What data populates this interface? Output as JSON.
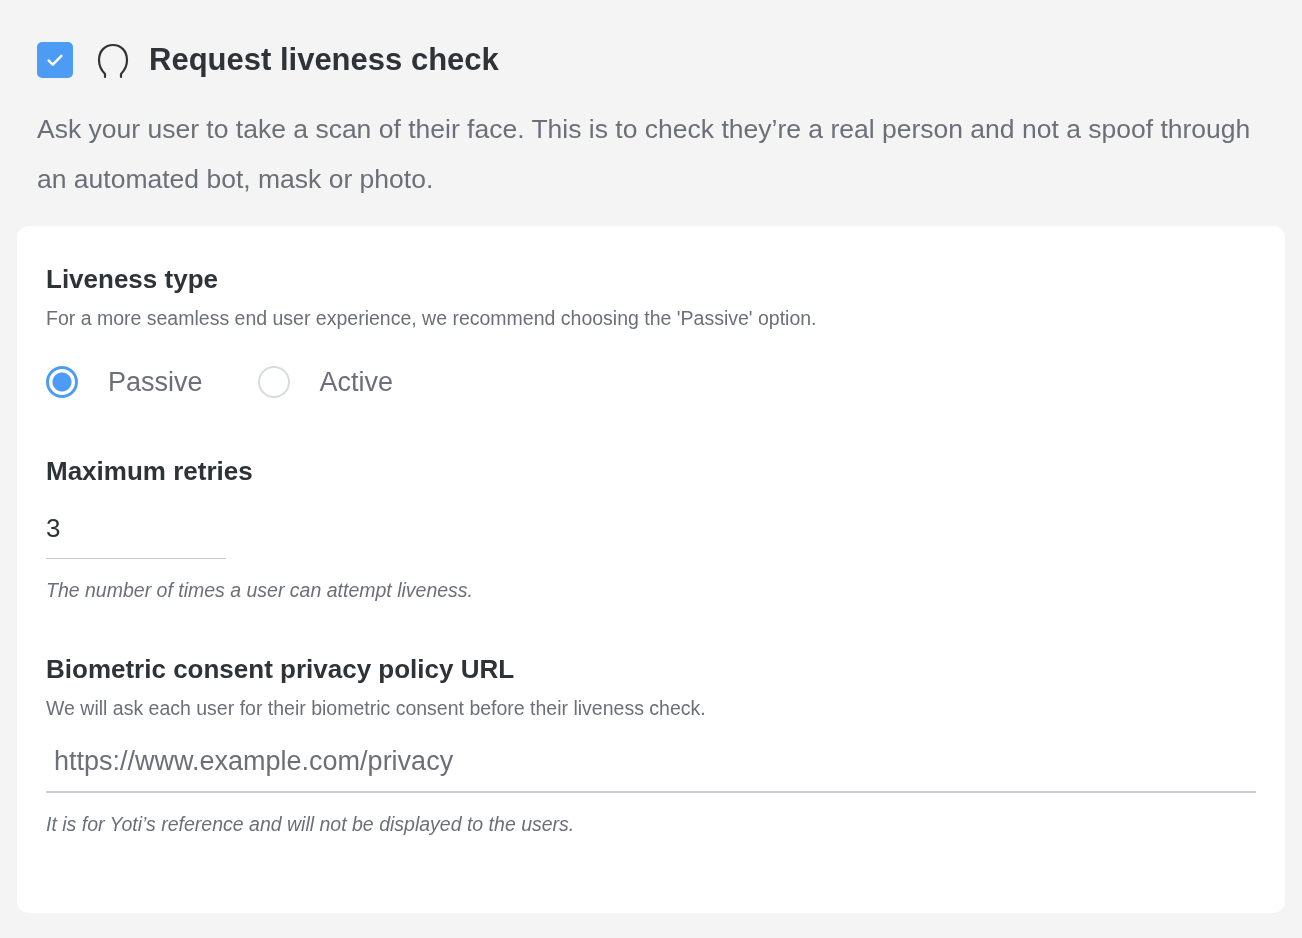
{
  "header": {
    "checked": true,
    "title": "Request liveness check",
    "description": "Ask your user to take a scan of their face. This is to check they’re a real person and not a spoof through an automated bot, mask or photo."
  },
  "sections": [
    {
      "kind": "radio",
      "title": "Liveness type",
      "subtitle": "For a more seamless end user experience, we recommend choosing the 'Passive' option.",
      "options": [
        {
          "label": "Passive",
          "selected": true
        },
        {
          "label": "Active",
          "selected": false
        }
      ]
    },
    {
      "kind": "number",
      "title": "Maximum retries",
      "value": "3",
      "hint": "The number of times a user can attempt liveness."
    },
    {
      "kind": "url",
      "title": "Biometric consent privacy policy URL",
      "subtitle": "We will ask each user for their biometric consent before their liveness check.",
      "placeholder": "https://www.example.com/privacy",
      "hint": "It is for Yoti’s reference and will not be displayed to the users."
    }
  ]
}
